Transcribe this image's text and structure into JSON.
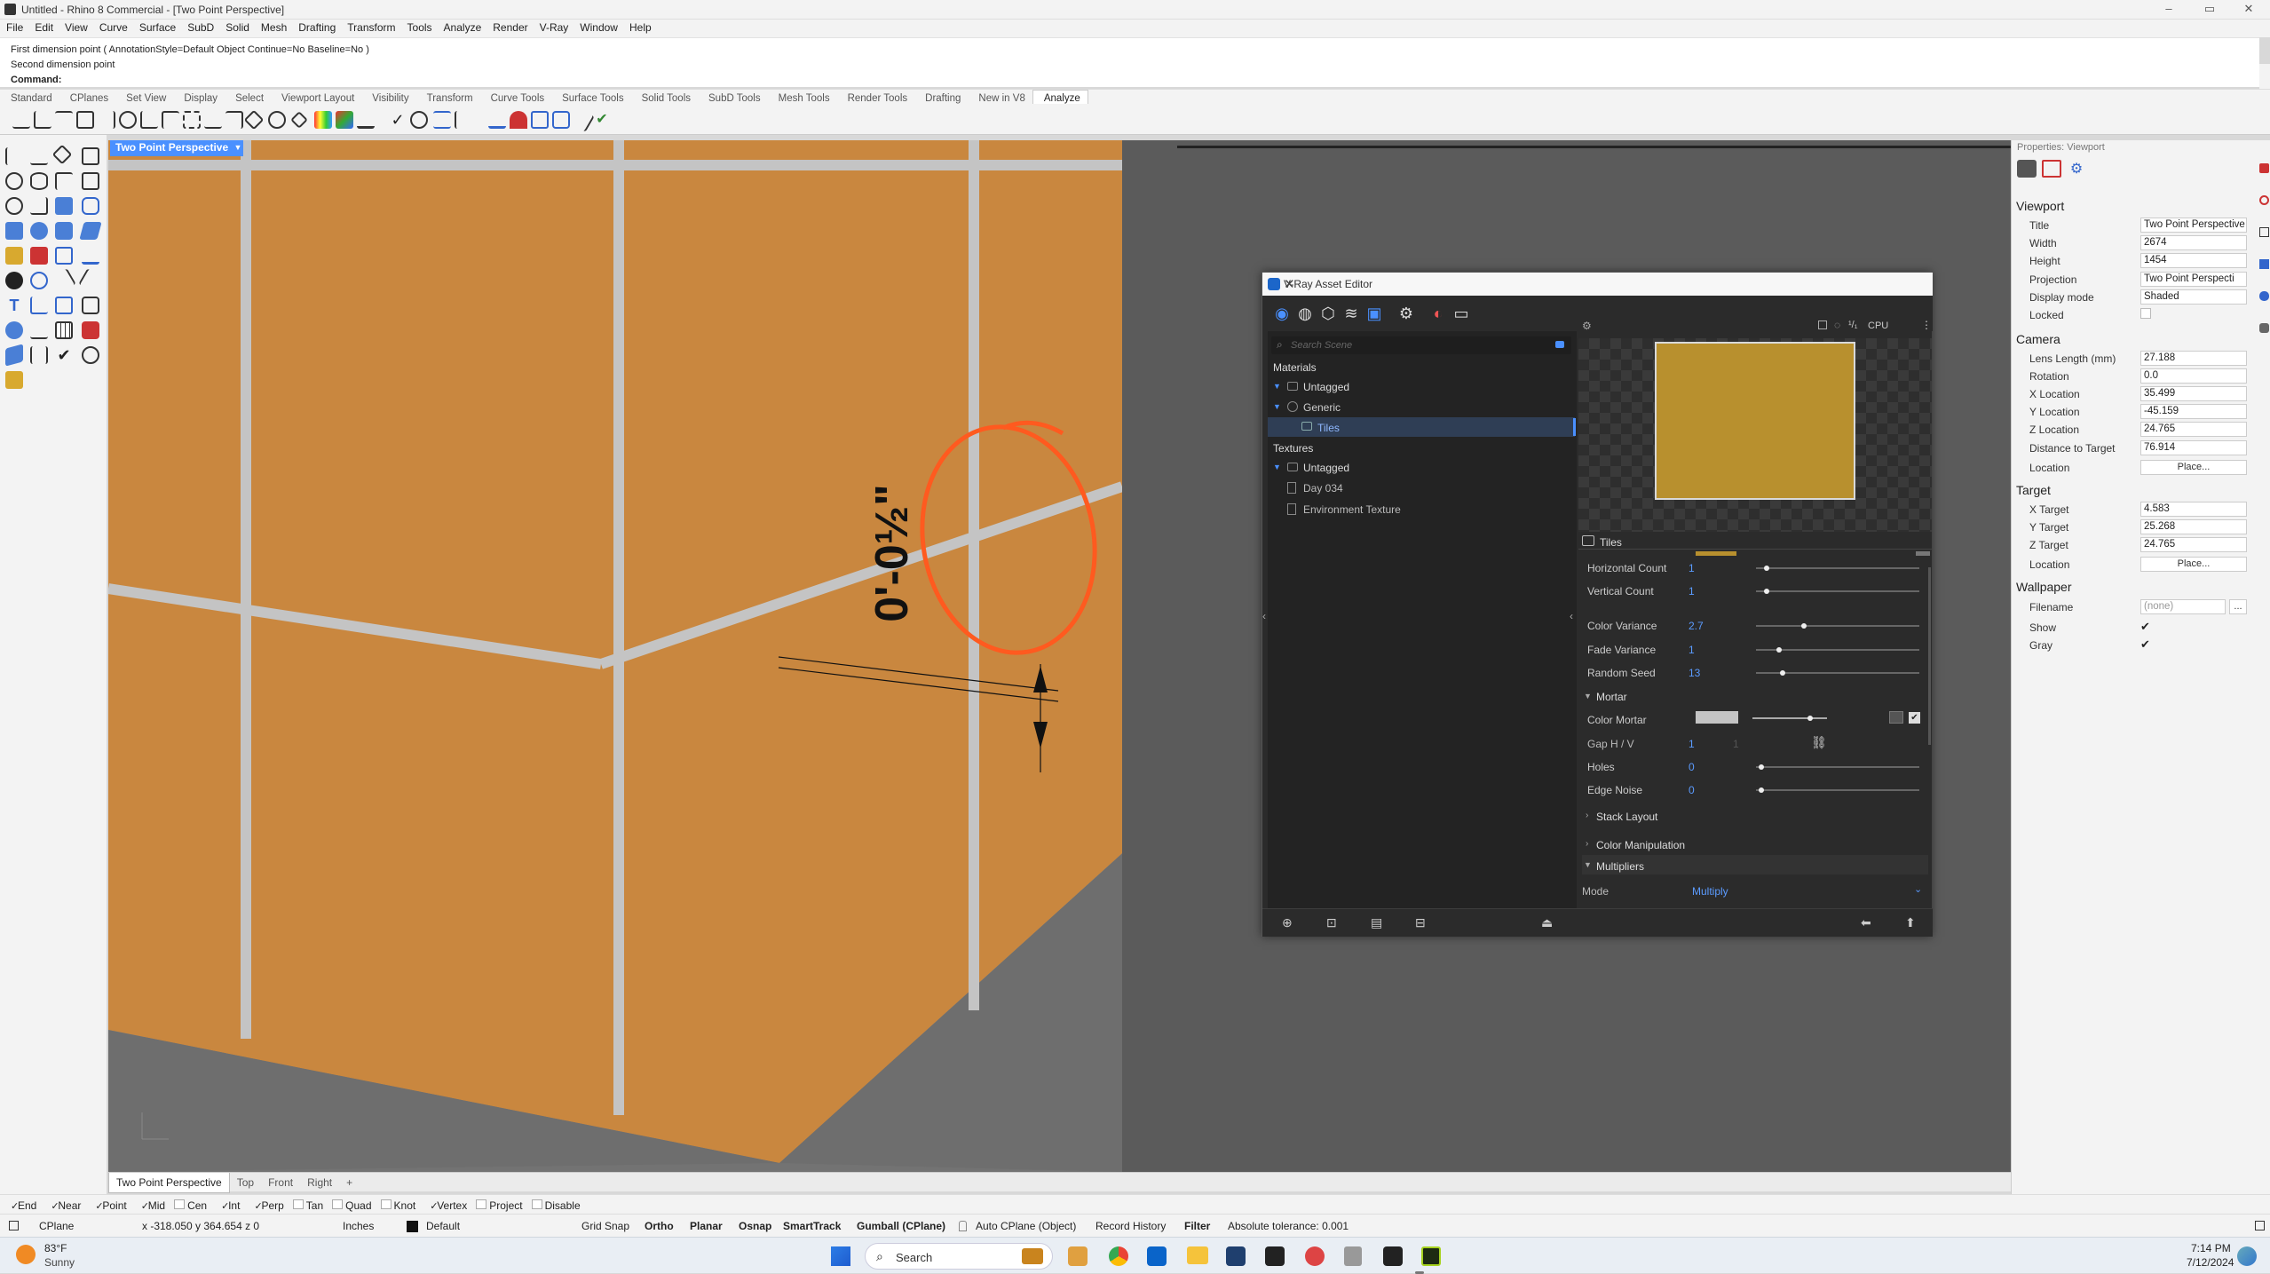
{
  "window": {
    "title": "Untitled - Rhino 8 Commercial - [Two Point Perspective]",
    "controls": [
      "–",
      "▭",
      "✕"
    ]
  },
  "menu": [
    "File",
    "Edit",
    "View",
    "Curve",
    "Surface",
    "SubD",
    "Solid",
    "Mesh",
    "Drafting",
    "Transform",
    "Tools",
    "Analyze",
    "Render",
    "V-Ray",
    "Window",
    "Help"
  ],
  "command": {
    "history": [
      "First dimension point ( AnnotationStyle=Default  Object  Continue=No  Baseline=No )",
      "Second dimension point"
    ],
    "prompt": "Command:"
  },
  "toolbar_tabs": [
    "Standard",
    "CPlanes",
    "Set View",
    "Display",
    "Select",
    "Viewport Layout",
    "Visibility",
    "Transform",
    "Curve Tools",
    "Surface Tools",
    "Solid Tools",
    "SubD Tools",
    "Mesh Tools",
    "Render Tools",
    "Drafting",
    "New in V8",
    "Analyze"
  ],
  "toolbar_active_tab": "Analyze",
  "viewport": {
    "active_tab": "Two Point Perspective",
    "dimension_label": "0'-0½\"",
    "bottom_tabs": [
      "Two Point Perspective",
      "Top",
      "Front",
      "Right",
      "+"
    ]
  },
  "vray": {
    "title": "V-Ray Asset Editor",
    "search_placeholder": "Search Scene",
    "tree": {
      "materials_header": "Materials",
      "materials_untagged": "Untagged",
      "generic": "Generic",
      "tiles": "Tiles",
      "textures_header": "Textures",
      "textures_untagged": "Untagged",
      "day": "Day 034",
      "env": "Environment Texture"
    },
    "preview": {
      "engine": "CPU",
      "swatch_color": "#b8902e"
    },
    "panel_title": "Tiles",
    "params": [
      {
        "label": "Horizontal Count",
        "value": "1"
      },
      {
        "label": "Vertical Count",
        "value": "1"
      },
      {
        "label": "Color Variance",
        "value": "2.7"
      },
      {
        "label": "Fade Variance",
        "value": "1"
      },
      {
        "label": "Random Seed",
        "value": "13"
      }
    ],
    "sections": {
      "mortar": "Mortar",
      "stack_layout": "Stack Layout",
      "color_manipulation": "Color Manipulation",
      "multipliers": "Multipliers"
    },
    "mortar": {
      "color_label": "Color Mortar",
      "gap_label": "Gap H / V",
      "gap_h": "1",
      "gap_v": "1",
      "holes_label": "Holes",
      "holes_value": "0",
      "edge_label": "Edge Noise",
      "edge_value": "0"
    },
    "mode_label": "Mode",
    "mode_value": "Multiply"
  },
  "properties": {
    "header": "Properties: Viewport",
    "viewport_section": "Viewport",
    "title_label": "Title",
    "title_value": "Two Point Perspective",
    "width_label": "Width",
    "width_value": "2674",
    "height_label": "Height",
    "height_value": "1454",
    "projection_label": "Projection",
    "projection_value": "Two Point Perspecti",
    "display_label": "Display mode",
    "display_value": "Shaded",
    "locked_label": "Locked",
    "camera_section": "Camera",
    "lens_label": "Lens Length (mm)",
    "lens_value": "27.188",
    "rotation_label": "Rotation",
    "rotation_value": "0.0",
    "xloc_label": "X Location",
    "xloc_value": "35.499",
    "yloc_label": "Y Location",
    "yloc_value": "-45.159",
    "zloc_label": "Z Location",
    "zloc_value": "24.765",
    "dist_label": "Distance to Target",
    "dist_value": "76.914",
    "loc_label": "Location",
    "place_label": "Place...",
    "target_section": "Target",
    "xt_label": "X Target",
    "xt_value": "4.583",
    "yt_label": "Y Target",
    "yt_value": "25.268",
    "zt_label": "Z Target",
    "zt_value": "24.765",
    "tloc_label": "Location",
    "tplace_label": "Place...",
    "wallpaper_section": "Wallpaper",
    "filename_label": "Filename",
    "filename_value": "(none)",
    "browse": "...",
    "show_label": "Show",
    "gray_label": "Gray"
  },
  "osnaps": [
    {
      "label": "End",
      "checked": true
    },
    {
      "label": "Near",
      "checked": true
    },
    {
      "label": "Point",
      "checked": true
    },
    {
      "label": "Mid",
      "checked": true
    },
    {
      "label": "Cen",
      "checked": false
    },
    {
      "label": "Int",
      "checked": true
    },
    {
      "label": "Perp",
      "checked": true
    },
    {
      "label": "Tan",
      "checked": false
    },
    {
      "label": "Quad",
      "checked": false
    },
    {
      "label": "Knot",
      "checked": false
    },
    {
      "label": "Vertex",
      "checked": true
    },
    {
      "label": "Project",
      "checked": false
    },
    {
      "label": "Disable",
      "checked": false
    }
  ],
  "status": {
    "cplane": "CPlane",
    "coords": "x -318.050  y 364.654  z 0",
    "units": "Inches",
    "layer": "Default",
    "grid_snap": "Grid Snap",
    "ortho": "Ortho",
    "planar": "Planar",
    "osnap": "Osnap",
    "smarttrack": "SmartTrack",
    "gumball": "Gumball (CPlane)",
    "auto_cplane": "Auto CPlane (Object)",
    "record_history": "Record History",
    "filter": "Filter",
    "tolerance": "Absolute tolerance: 0.001"
  },
  "taskbar": {
    "weather_temp": "83°F",
    "weather_desc": "Sunny",
    "search": "Search",
    "time": "7:14 PM",
    "date": "7/12/2024"
  },
  "colors": {
    "tile": "#c9873f",
    "mortar": "#c4c4c4",
    "accent": "#4a90ff",
    "annotation": "#ff5a1f"
  }
}
